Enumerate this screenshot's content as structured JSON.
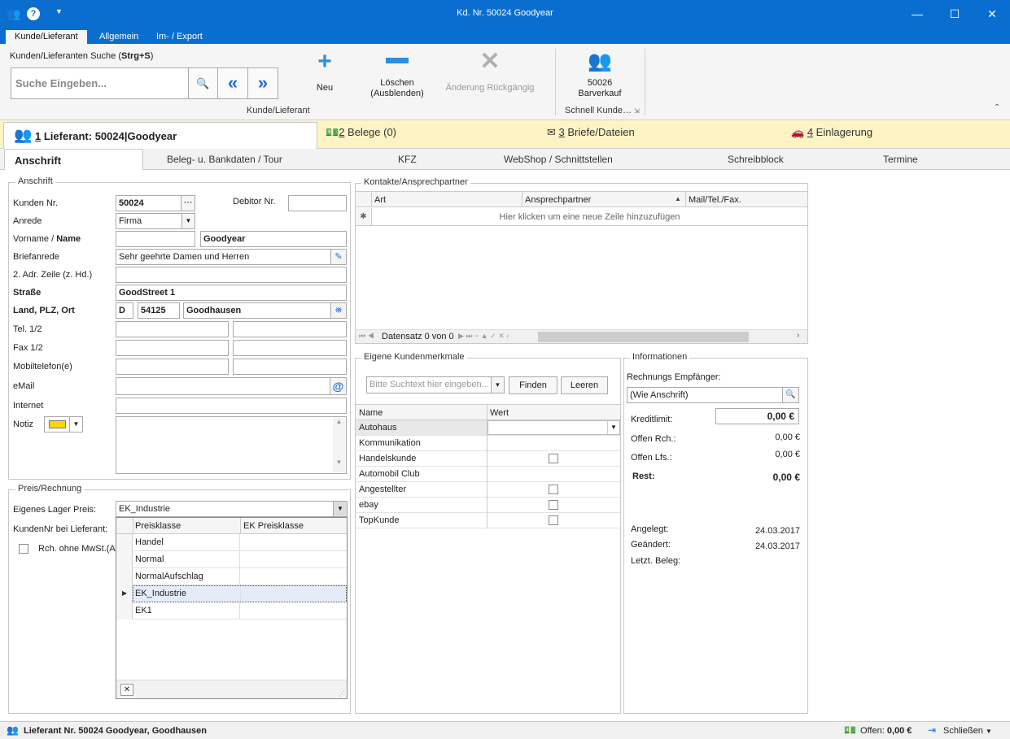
{
  "window": {
    "title": "Kd. Nr. 50024 Goodyear",
    "min": "—",
    "max": "☐",
    "close": "✕"
  },
  "ribbon_tabs": [
    "Kunde/Lieferant",
    "Allgemein",
    "Im- / Export"
  ],
  "search": {
    "label_prefix": "Kunden/Lieferanten Suche (",
    "label_bold": "Strg+S",
    "label_suffix": ")",
    "placeholder": "Suche Eingeben..."
  },
  "toolbar": {
    "neu": "Neu",
    "loeschen1": "Löschen",
    "loeschen2": "(Ausblenden)",
    "aenderung": "Änderung Rückgängig",
    "group1": "Kunde/Lieferant",
    "quick1": "50026",
    "quick2": "Barverkauf",
    "group2": "Schnell Kunde…"
  },
  "maintabs": {
    "t1n": "1",
    "t1": " Lieferant: 50024|Goodyear",
    "t2n": "2",
    "t2": " Belege (0)",
    "t3n": "3",
    "t3": " Briefe/Dateien",
    "t4n": "4",
    "t4": " Einlagerung"
  },
  "subtabs": [
    "Anschrift",
    "Beleg- u. Bankdaten / Tour",
    "KFZ",
    "WebShop / Schnittstellen",
    "Schreibblock",
    "Termine"
  ],
  "anschrift": {
    "title": "Anschrift",
    "kunden_nr_label": "Kunden Nr.",
    "kunden_nr": "50024",
    "debitor_label": "Debitor Nr.",
    "debitor": "",
    "anrede_label": "Anrede",
    "anrede": "Firma",
    "vorname_label": "Vorname / ",
    "name_label": "Name",
    "vorname": "",
    "name": "Goodyear",
    "briefanrede_label": "Briefanrede",
    "briefanrede": "Sehr geehrte Damen und Herren",
    "adr2_label": "2. Adr. Zeile (z. Hd.)",
    "adr2": "",
    "strasse_label": "Straße",
    "strasse": "GoodStreet 1",
    "land_label": "Land, PLZ, Ort",
    "land": "D",
    "plz": "54125",
    "ort": "Goodhausen",
    "tel_label": "Tel. 1/2",
    "fax_label": "Fax 1/2",
    "mobil_label": "Mobiltelefon(e)",
    "email_label": "eMail",
    "internet_label": "Internet",
    "notiz_label": "Notiz",
    "notiz_color": "#ffd700"
  },
  "preis": {
    "title": "Preis/Rechnung",
    "lager_label": "Eigenes Lager Preis:",
    "lager_value": "EK_Industrie",
    "kundennr_label": "KundenNr bei Lieferant:",
    "rch_label": "Rch. ohne MwSt.(Au",
    "dropdown": {
      "col1": "Preisklasse",
      "col2": "EK Preisklasse",
      "rows": [
        "Handel",
        "Normal",
        "NormalAufschlag",
        "EK_Industrie",
        "EK1"
      ],
      "close": "✕"
    }
  },
  "kontakte": {
    "title": "Kontakte/Ansprechpartner",
    "col1": "Art",
    "col2": "Ansprechpartner",
    "col3": "Mail/Tel./Fax.",
    "newrow": "Hier klicken um eine neue Zeile hinzuzufügen",
    "nav": "Datensatz 0 von 0"
  },
  "merkmale": {
    "title": "Eigene Kundenmerkmale",
    "search_placeholder": "Bitte Suchtext hier eingeben...",
    "finden": "Finden",
    "leeren": "Leeren",
    "col1": "Name",
    "col2": "Wert",
    "rows": [
      "Autohaus",
      "Kommunikation",
      "Handelskunde",
      "Automobil Club",
      "Angestellter",
      "ebay",
      "TopKunde"
    ]
  },
  "info": {
    "title": "Informationen",
    "empf_label": "Rechnungs Empfänger:",
    "empf": "(Wie Anschrift)",
    "kredit_label": "Kreditlimit:",
    "kredit": "0,00 €",
    "offen_rch_label": "Offen Rch.:",
    "offen_rch": "0,00 €",
    "offen_lfs_label": "Offen Lfs.:",
    "offen_lfs": "0,00 €",
    "rest_label": "Rest:",
    "rest": "0,00 €",
    "angelegt_label": "Angelegt:",
    "angelegt": "24.03.2017",
    "geaendert_label": "Geändert:",
    "geaendert": "24.03.2017",
    "letzt_label": "Letzt. Beleg:"
  },
  "status": {
    "left": "Lieferant Nr. 50024 Goodyear, Goodhausen",
    "offen_label": "Offen: ",
    "offen": "0,00 €",
    "schliessen": "Schließen"
  }
}
